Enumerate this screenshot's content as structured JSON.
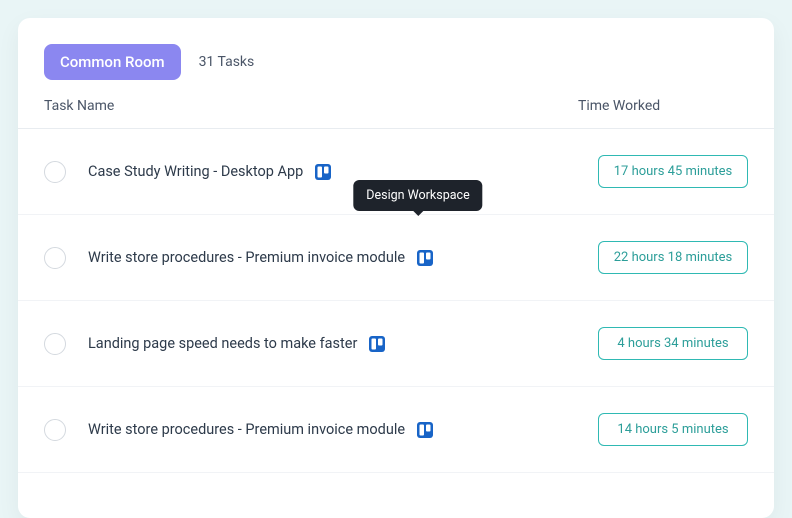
{
  "header": {
    "project_badge": "Common Room",
    "task_count": "31 Tasks"
  },
  "columns": {
    "task_name": "Task Name",
    "time_worked": "Time Worked"
  },
  "tooltip": "Design Workspace",
  "tasks": [
    {
      "name": "Case Study Writing - Desktop App",
      "time": "17 hours 45 minutes",
      "drag": false,
      "tooltip": false
    },
    {
      "name": "Write store procedures - Premium invoice module",
      "time": "22 hours 18 minutes",
      "drag": true,
      "tooltip": true
    },
    {
      "name": "Landing page speed needs to make faster",
      "time": "4 hours 34 minutes",
      "drag": false,
      "tooltip": false
    },
    {
      "name": "Write store procedures - Premium invoice module",
      "time": "14 hours 5 minutes",
      "drag": false,
      "tooltip": false
    }
  ]
}
